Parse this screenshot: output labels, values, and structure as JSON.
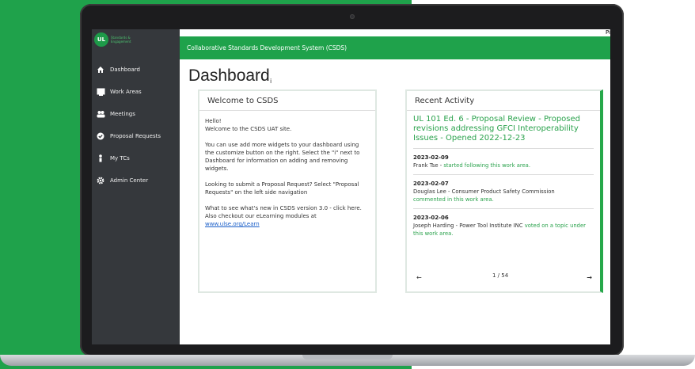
{
  "app": {
    "logo_text": "Standards & Engagement",
    "logo_initials": "UL",
    "header_title": "Collaborative Standards Development System (CSDS)",
    "header_edge_text": "Pi"
  },
  "sidebar": {
    "items": [
      {
        "label": "Dashboard",
        "icon": "home-icon"
      },
      {
        "label": "Work Areas",
        "icon": "window-icon"
      },
      {
        "label": "Meetings",
        "icon": "people-icon"
      },
      {
        "label": "Proposal Requests",
        "icon": "check-circle-icon"
      },
      {
        "label": "My TCs",
        "icon": "person-icon"
      },
      {
        "label": "Admin Center",
        "icon": "gear-icon"
      }
    ]
  },
  "page": {
    "title": "Dashboard",
    "info_glyph": "i"
  },
  "welcome": {
    "title": "Welcome to CSDS",
    "hello": "Hello!",
    "line1": "Welcome to the CSDS UAT site.",
    "para2": "You can use add more widgets to your dashboard using the customize button on the right. Select the \"i\" next to Dashboard for information on adding and removing widgets.",
    "para3": "Looking to submit a Proposal Request? Select \"Proposal Requests\" on the left side navigation",
    "para4": "What to see what's new in CSDS version 3.0 - click here. Also checkout our eLearning modules at",
    "link": "www.ulse.org/Learn"
  },
  "activity": {
    "title": "Recent Activity",
    "headline": "UL 101 Ed. 6 - Proposal Review - Proposed revisions addressing GFCI Interoperability Issues - Opened 2022-12-23",
    "entries": [
      {
        "date": "2023-02-09",
        "who": "Frank Tse - ",
        "action": "started following this work area.",
        "rest": ""
      },
      {
        "date": "2023-02-07",
        "who": "Douglas Lee - Consumer Product Safety Commission",
        "action": "commented in this work area.",
        "rest": ""
      },
      {
        "date": "2023-02-06",
        "who": "Joseph Harding - Power Tool Institute INC",
        "action": "voted on a topic under this work area.",
        "rest": ""
      }
    ],
    "pager": {
      "prev": "←",
      "count": "1 / 54",
      "next": "→"
    }
  },
  "colors": {
    "brand_green": "#1fa24b",
    "sidebar_bg": "#35383c",
    "link": "#1a5ec8"
  }
}
